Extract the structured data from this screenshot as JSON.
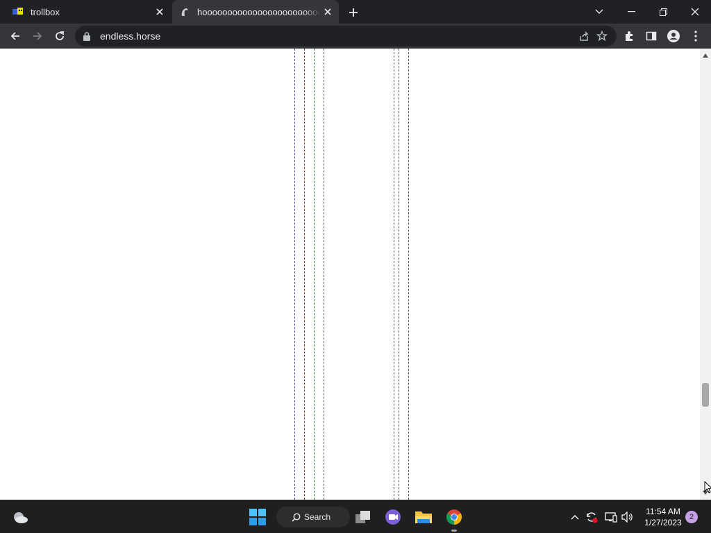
{
  "browser": {
    "tabs": [
      {
        "title": "trollbox",
        "favicon": "trollbox-icon",
        "active": false
      },
      {
        "title": "hooooooooooooooooooooooooooooooooooooooooooooooooooooooooooooooooooooo",
        "favicon": "horse-icon",
        "active": true
      }
    ],
    "url": "endless.horse",
    "accent": "#35363a"
  },
  "page": {
    "background": "#ffffff",
    "legs": [
      {
        "color": "#4a4a8a"
      },
      {
        "color": "#8a3a3a"
      },
      {
        "color": "#4a7a4a"
      },
      {
        "color": "#555555"
      },
      {
        "color": "#555555"
      },
      {
        "color": "#555555"
      },
      {
        "color": "#555555"
      }
    ]
  },
  "taskbar": {
    "search_label": "Search",
    "clock_time": "11:54 AM",
    "clock_date": "1/27/2023",
    "notification_count": "2"
  }
}
